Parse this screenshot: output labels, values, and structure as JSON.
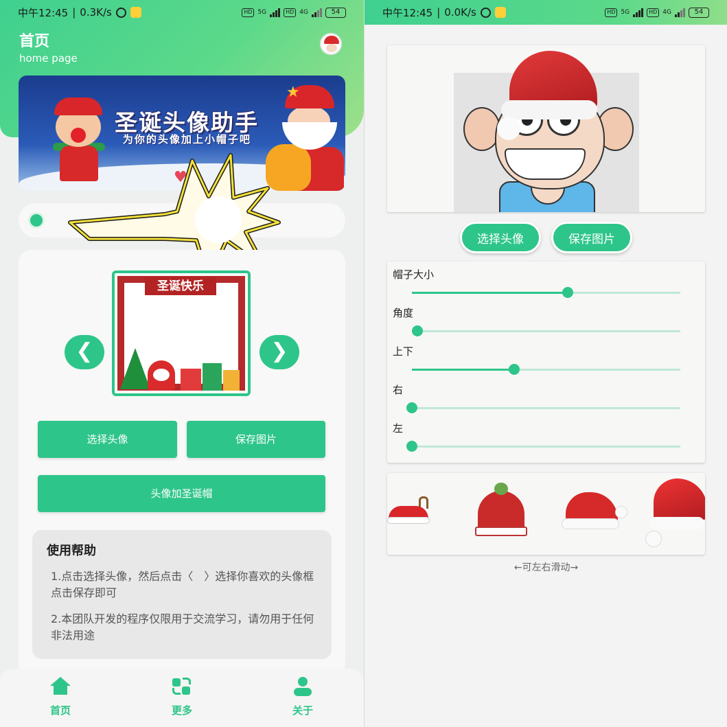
{
  "left": {
    "status_bar": {
      "time": "中午12:45",
      "speed": "0.3K/s",
      "battery": "54",
      "hd": "HD",
      "net1": "5G",
      "net2": "4G"
    },
    "header": {
      "title": "首页",
      "subtitle": "home page"
    },
    "banner": {
      "title": "圣诞头像助手",
      "subtitle": "为你的头像加上小帽子吧"
    },
    "frame": {
      "ribbon": "圣诞快乐",
      "prev_icon": "chevron-left-icon",
      "next_icon": "chevron-right-icon",
      "prev_glyph": "❮",
      "next_glyph": "❯"
    },
    "buttons": {
      "choose": "选择头像",
      "save": "保存图片",
      "add_hat": "头像加圣诞帽"
    },
    "help": {
      "title": "使用帮助",
      "p1": "1.点击选择头像，然后点击〈　〉选择你喜欢的头像框点击保存即可",
      "p2": "2.本团队开发的程序仅限用于交流学习，请勿用于任何非法用途"
    },
    "tabs": [
      {
        "label": "首页",
        "icon": "home-icon"
      },
      {
        "label": "更多",
        "icon": "swap-icon"
      },
      {
        "label": "关于",
        "icon": "user-icon"
      }
    ]
  },
  "right": {
    "status_bar": {
      "time": "中午12:45",
      "speed": "0.0K/s",
      "battery": "54",
      "hd": "HD",
      "net1": "5G",
      "net2": "4G"
    },
    "buttons": {
      "choose": "选择头像",
      "save": "保存图片"
    },
    "sliders": [
      {
        "label": "帽子大小",
        "value": 0.58
      },
      {
        "label": "角度",
        "value": 0.02
      },
      {
        "label": "上下",
        "value": 0.38
      },
      {
        "label": "右",
        "value": 0.0
      },
      {
        "label": "左",
        "value": 0.0
      }
    ],
    "hats": [
      "reindeer-hat-icon",
      "knit-hat-icon",
      "santa-hat-icon",
      "santa-hat-large-icon"
    ],
    "scroll_hint": "←可左右滑动→"
  },
  "colors": {
    "accent": "#2ec58a",
    "header_gradient_start": "#3fd08f",
    "header_gradient_end": "#9fe08a"
  }
}
